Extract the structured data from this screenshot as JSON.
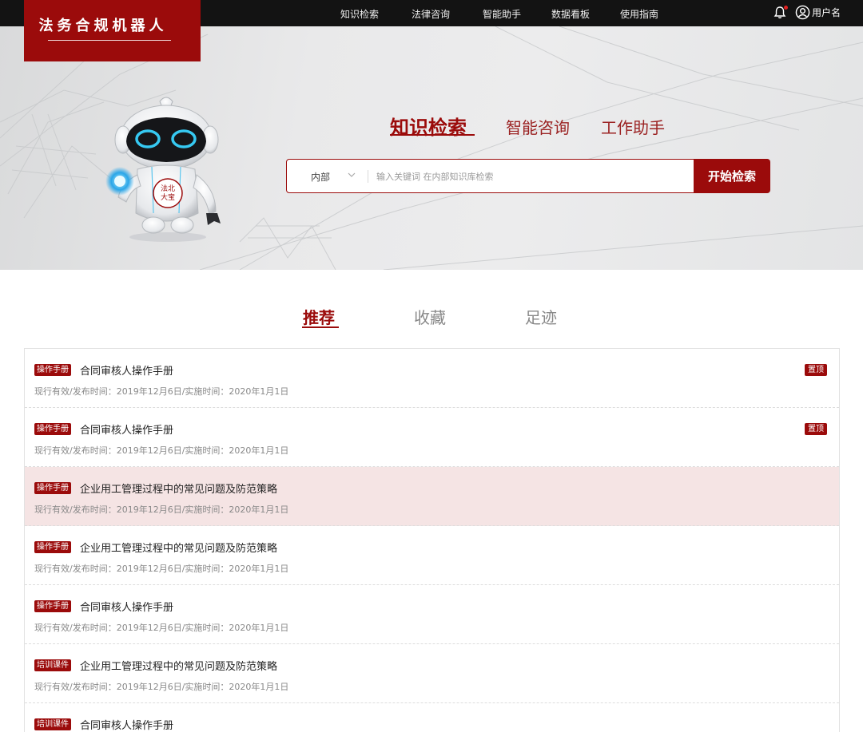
{
  "logo": {
    "text": "法务合规机器人"
  },
  "nav": {
    "items": [
      "知识检索",
      "法律咨询",
      "智能助手",
      "数据看板",
      "使用指南"
    ],
    "user_label": "用户名"
  },
  "search": {
    "tabs": [
      "知识检索",
      "智能咨询",
      "工作助手"
    ],
    "scope": "内部",
    "placeholder": "输入关键词 在内部知识库检索",
    "button": "开始检索"
  },
  "robot": {
    "badge_text": "法北大宝"
  },
  "list_tabs": [
    "推荐",
    "收藏",
    "足迹"
  ],
  "list": [
    {
      "tag": "操作手册",
      "title": "合同审核人操作手册",
      "meta": "现行有效/发布时间：2019年12月6日/实施时间：2020年1月1日",
      "pinned": "置顶"
    },
    {
      "tag": "操作手册",
      "title": "合同审核人操作手册",
      "meta": "现行有效/发布时间：2019年12月6日/实施时间：2020年1月1日",
      "pinned": "置顶"
    },
    {
      "tag": "操作手册",
      "title": "企业用工管理过程中的常见问题及防范策略",
      "meta": "现行有效/发布时间：2019年12月6日/实施时间：2020年1月1日",
      "pinned": ""
    },
    {
      "tag": "操作手册",
      "title": "企业用工管理过程中的常见问题及防范策略",
      "meta": "现行有效/发布时间：2019年12月6日/实施时间：2020年1月1日",
      "pinned": ""
    },
    {
      "tag": "操作手册",
      "title": "合同审核人操作手册",
      "meta": "现行有效/发布时间：2019年12月6日/实施时间：2020年1月1日",
      "pinned": ""
    },
    {
      "tag": "培训课件",
      "title": "企业用工管理过程中的常见问题及防范策略",
      "meta": "现行有效/发布时间：2019年12月6日/实施时间：2020年1月1日",
      "pinned": ""
    },
    {
      "tag": "培训课件",
      "title": "合同审核人操作手册",
      "meta": "",
      "pinned": ""
    }
  ],
  "colors": {
    "brand": "#9b0b0b",
    "highlight_row": "#f5e4e4",
    "topbar": "#131313"
  }
}
